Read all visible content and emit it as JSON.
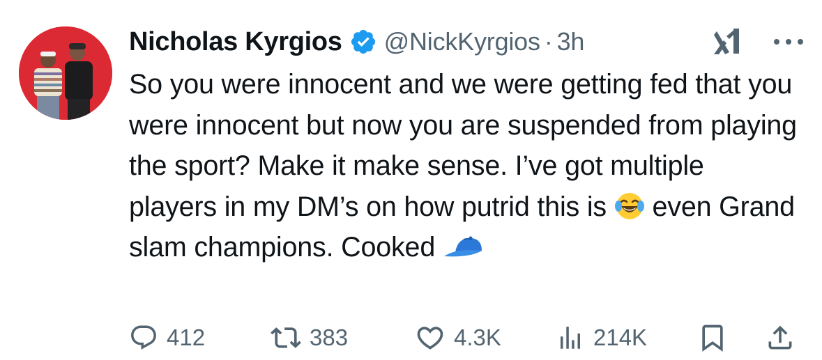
{
  "tweet": {
    "author_name": "Nicholas Kyrgios",
    "handle": "@NickKyrgios",
    "separator": "·",
    "time": "3h",
    "text_before_emoji": "So you were innocent and we were getting fed that you were innocent but now you are suspended from playing the sport? Make it make sense. I’ve got multiple players in my DM’s on how putrid this is ",
    "text_after_emoji": " even Grand slam champions. Cooked ",
    "emoji_1": "face-with-tears-of-joy-emoji",
    "emoji_2": "billed-cap-emoji"
  },
  "actions": {
    "replies": "412",
    "reposts": "383",
    "likes": "4.3K",
    "views": "214K"
  },
  "icons": {
    "verified": "verified-badge-icon",
    "grok": "grok-icon",
    "more": "more-icon",
    "reply": "reply-icon",
    "repost": "repost-icon",
    "like": "heart-icon",
    "views": "views-icon",
    "bookmark": "bookmark-icon",
    "share": "share-icon"
  },
  "colors": {
    "text": "#0f1419",
    "secondary": "#536471",
    "verified": "#1d9bf0",
    "avatar_bg": "#e0303a"
  }
}
